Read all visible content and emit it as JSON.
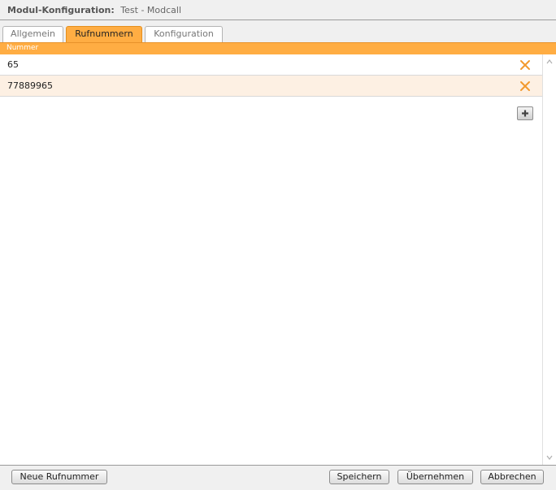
{
  "window": {
    "title_label": "Modul-Konfiguration:",
    "title_value": "Test - Modcall"
  },
  "tabs": [
    {
      "label": "Allgemein",
      "active": false
    },
    {
      "label": "Rufnummern",
      "active": true
    },
    {
      "label": "Konfiguration",
      "active": false
    }
  ],
  "table": {
    "column_header": "Nummer",
    "rows": [
      {
        "number": "65"
      },
      {
        "number": "77889965"
      }
    ]
  },
  "icons": {
    "delete": "close-x-icon",
    "add": "plus-icon",
    "scroll_up": "triangle-up-icon",
    "scroll_down": "triangle-down-icon"
  },
  "footer": {
    "new_number_label": "Neue Rufnummer",
    "save_label": "Speichern",
    "apply_label": "Übernehmen",
    "cancel_label": "Abbrechen"
  },
  "colors": {
    "accent": "#ffad43",
    "delete_icon": "#f29a2e",
    "alt_row": "#fdf0e3"
  }
}
